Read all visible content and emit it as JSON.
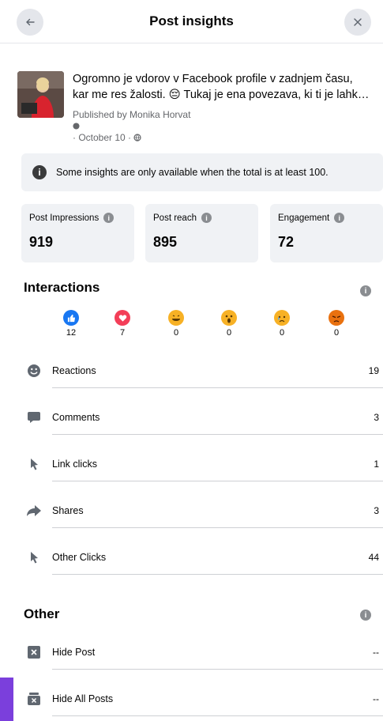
{
  "header": {
    "title": "Post insights",
    "back_icon": "arrow-left-icon",
    "close_icon": "close-icon"
  },
  "post": {
    "text_line1": "Ogromno je vdorov v Facebook profile v zadnjem času,",
    "text_line2": "kar me res žalosti. 😔 Tukaj je ena povezava, ki ti je lahk…",
    "published_by": "Published by Monika Horvat",
    "date": "· October 10 ·"
  },
  "notice": {
    "text": "Some insights are only available when the total is at least 100."
  },
  "stats": [
    {
      "label": "Post Impressions",
      "value": "919"
    },
    {
      "label": "Post reach",
      "value": "895"
    },
    {
      "label": "Engagement",
      "value": "72"
    }
  ],
  "interactions": {
    "title": "Interactions",
    "reactions": [
      {
        "name": "like",
        "count": "12",
        "color": "#1877f2"
      },
      {
        "name": "love",
        "count": "7",
        "color": "#f33e58"
      },
      {
        "name": "haha",
        "count": "0",
        "color": "#f7b125"
      },
      {
        "name": "wow",
        "count": "0",
        "color": "#f7b125"
      },
      {
        "name": "sad",
        "count": "0",
        "color": "#f7b125"
      },
      {
        "name": "angry",
        "count": "0",
        "color": "#e9710f"
      }
    ],
    "rows": [
      {
        "label": "Reactions",
        "value": "19",
        "icon": "smiley-icon"
      },
      {
        "label": "Comments",
        "value": "3",
        "icon": "comment-icon"
      },
      {
        "label": "Link clicks",
        "value": "1",
        "icon": "cursor-icon"
      },
      {
        "label": "Shares",
        "value": "3",
        "icon": "share-icon"
      },
      {
        "label": "Other Clicks",
        "value": "44",
        "icon": "cursor-icon"
      }
    ]
  },
  "other": {
    "title": "Other",
    "rows": [
      {
        "label": "Hide Post",
        "value": "--",
        "icon": "hide-post-icon"
      },
      {
        "label": "Hide All Posts",
        "value": "--",
        "icon": "hide-all-posts-icon"
      }
    ]
  }
}
